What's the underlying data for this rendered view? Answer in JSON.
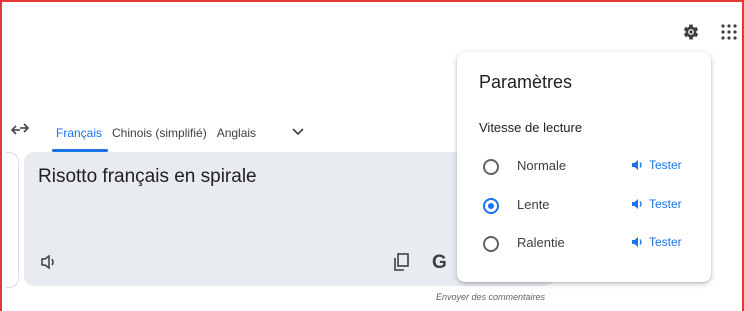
{
  "header": {
    "settings_icon": "gear-icon",
    "apps_icon": "apps-grid-icon"
  },
  "languages": {
    "swap_icon": "swap-arrows-icon",
    "tabs": [
      {
        "label": "Français",
        "active": true
      },
      {
        "label": "Chinois (simplifié)",
        "active": false
      },
      {
        "label": "Anglais",
        "active": false
      }
    ],
    "more_icon": "chevron-down-icon"
  },
  "source": {
    "text": "Risotto français en spirale",
    "listen_icon": "speaker-icon",
    "copy_icon": "copy-icon",
    "g_logo": "G"
  },
  "footer": {
    "feedback_label": "Envoyer des commentaires"
  },
  "settings_panel": {
    "title": "Paramètres",
    "subtitle": "Vitesse de lecture",
    "options": [
      {
        "label": "Normale",
        "selected": false,
        "test_label": "Tester"
      },
      {
        "label": "Lente",
        "selected": true,
        "test_label": "Tester"
      },
      {
        "label": "Ralentie",
        "selected": false,
        "test_label": "Tester"
      }
    ]
  },
  "colors": {
    "accent": "#1a73e8",
    "frame_border": "#e53935",
    "textbox_bg": "#e8ebf0"
  }
}
